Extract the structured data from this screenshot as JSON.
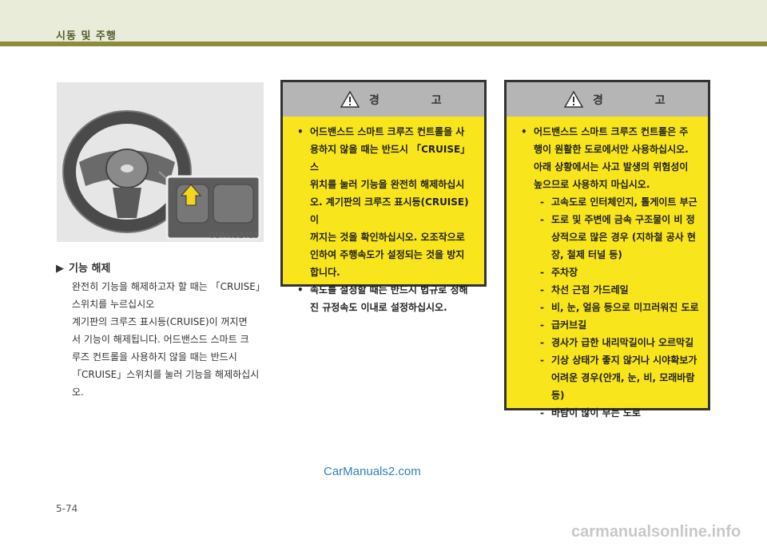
{
  "header": {
    "title": "시동 및 주행"
  },
  "figure": {
    "code": "ODM052025"
  },
  "section": {
    "heading": "기능 해제",
    "lines": [
      "완전히 기능을 해제하고자 할 때는 「CRUISE」",
      "스위치를 누르십시오",
      "계기판의 크루즈 표시등(CRUISE)이 꺼지면",
      "서 기능이 해제됩니다. 어드밴스드 스마트 크",
      "루즈 컨트롤을 사용하지 않을 때는 반드시",
      "「CRUISE」스위치를 눌러 기능을 해제하십시오."
    ]
  },
  "warning1": {
    "title": "경 고",
    "bullets": [
      [
        "어드밴스드 스마트 크루즈 컨트롤을 사",
        "용하지 않을 때는 반드시 「CRUISE」스",
        "위치를 눌러 기능을 완전히 해제하십시",
        "오. 계기판의 크루즈 표시등(CRUISE)이",
        "꺼지는 것을 확인하십시오. 오조작으로",
        "인하여 주행속도가 설정되는 것을 방지",
        "합니다."
      ],
      [
        "속도를 설정할 때는 반드시 법규로 정해",
        "진 규정속도 이내로 설정하십시오."
      ]
    ]
  },
  "warning2": {
    "title": "경 고",
    "bullet": [
      "어드밴스드 스마트 크루즈 컨트롤은 주",
      "행이 원활한 도로에서만 사용하십시오.",
      "아래 상황에서는 사고 발생의 위험성이",
      "높으므로 사용하지 마십시오."
    ],
    "dashes": [
      [
        "고속도로 인터체인지, 톨게이트 부근"
      ],
      [
        "도로 및 주변에 금속 구조물이 비 정",
        "상적으로 많은 경우 (지하철 공사 현",
        "장, 철제 터널 등)"
      ],
      [
        "주차장"
      ],
      [
        "차선 근접 가드레일"
      ],
      [
        "비, 눈, 얼음 등으로 미끄러워진 도로"
      ],
      [
        "급커브길"
      ],
      [
        "경사가 급한 내리막길이나 오르막길"
      ],
      [
        "기상 상태가 좋지 않거나 시야확보가",
        "어려운 경우(안개, 눈, 비, 모래바람 등)"
      ],
      [
        "바람이 많이 부는 도로"
      ]
    ]
  },
  "watermark_top": "CarManuals2.com",
  "page_number": "5-74",
  "watermark_bottom": "carmanualsonline.info",
  "colors": {
    "header_bg": "#e9ecd8",
    "header_bar": "#8c8c3c",
    "warning_bg": "#f8e51c",
    "warning_head": "#b5b5b5"
  },
  "icons": [
    "warning-triangle-icon",
    "play-triangle-icon"
  ]
}
